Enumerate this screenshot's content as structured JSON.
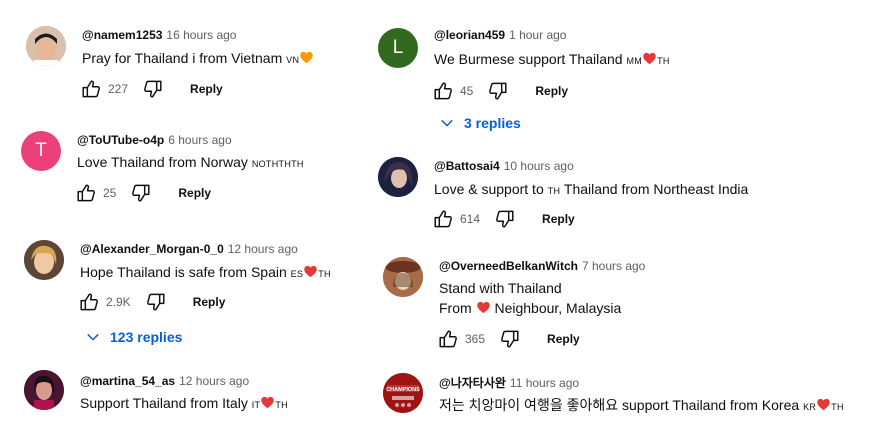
{
  "comments": [
    {
      "handle": "@namem1253",
      "time": "16 hours ago",
      "text": "Pray for Thailand i from Vietnam",
      "tags": "VN",
      "likes": "227",
      "reply": "Reply",
      "avatar_color": "#c9a58b"
    },
    {
      "handle": "@ToUTube-o4p",
      "time": "6 hours ago",
      "text": "Love Thailand from Norway",
      "tags": "NOTHTHTH",
      "likes": "25",
      "reply": "Reply",
      "avatar_letter": "T",
      "avatar_color": "#ec407a"
    },
    {
      "handle": "@Alexander_Morgan-0_0",
      "time": "12 hours ago",
      "text": "Hope Thailand is safe from Spain",
      "tags": "ES",
      "tags2": "TH",
      "likes": "2.9K",
      "reply": "Reply",
      "replies": "123 replies",
      "avatar_color": "#b37a4c"
    },
    {
      "handle": "@martina_54_as",
      "time": "12 hours ago",
      "text": "Support Thailand from Italy",
      "tags": "IT",
      "tags2": "TH",
      "avatar_color": "#7a2a45"
    },
    {
      "handle": "@leorian459",
      "time": "1 hour ago",
      "text": "We Burmese support Thailand",
      "tags": "MM",
      "tags2": "TH",
      "likes": "45",
      "reply": "Reply",
      "replies": "3 replies",
      "avatar_letter": "L",
      "avatar_color": "#33691e"
    },
    {
      "handle": "@Battosai4",
      "time": "10 hours ago",
      "text_before": "Love & support to",
      "tags": "TH",
      "text_after": "Thailand from Northeast India",
      "likes": "614",
      "reply": "Reply",
      "avatar_color": "#2b2f4f"
    },
    {
      "handle": "@OverneedBelkanWitch",
      "time": "7 hours ago",
      "line1": "Stand with Thailand",
      "line2_before": "From",
      "line2_after": "Neighbour, Malaysia",
      "likes": "365",
      "reply": "Reply",
      "avatar_color": "#8a4a2e"
    },
    {
      "handle": "@나자타사완",
      "time": "11 hours ago",
      "text": "저는 치앙마이 여행을 좋아해요 support Thailand from Korea",
      "tags": "KR",
      "tags2": "TH",
      "avatar_text_1": "CHAMPIONS",
      "avatar_color": "#b71c1c"
    }
  ],
  "icons": {
    "like": "thumbs-up-icon",
    "dislike": "thumbs-down-icon",
    "expand": "chevron-down-icon",
    "heart": "red-heart-emoji",
    "orange_heart": "orange-heart-emoji"
  },
  "colors": {
    "link": "#065fd4",
    "meta": "#606060",
    "heart": "#e53935",
    "orange_heart": "#ff9800"
  }
}
